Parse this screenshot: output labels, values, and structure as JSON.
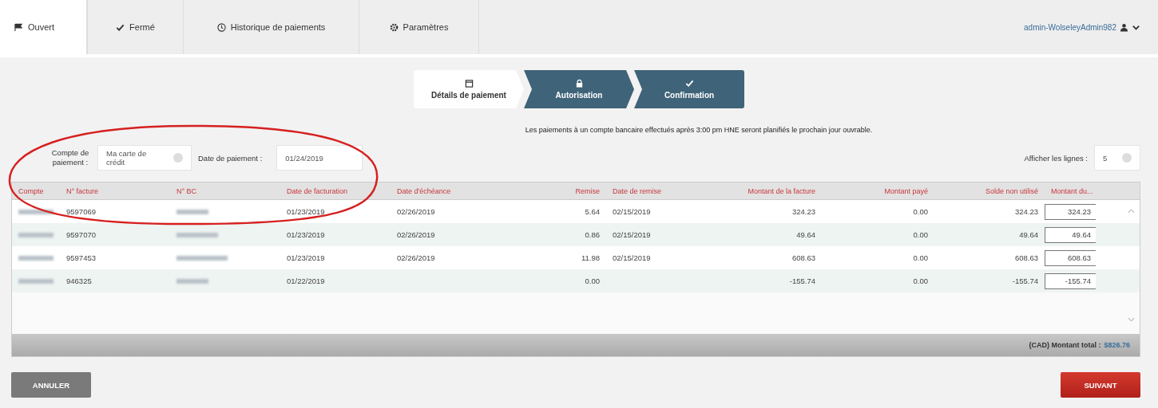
{
  "tabs": [
    {
      "label": "Ouvert",
      "selected": true
    },
    {
      "label": "Fermé",
      "selected": false
    },
    {
      "label": "Historique de paiements",
      "selected": false
    },
    {
      "label": "Paramètres",
      "selected": false
    }
  ],
  "user": {
    "name": "admin-WolseleyAdmin982"
  },
  "stepper": [
    {
      "label": "Détails de paiement",
      "selected": true
    },
    {
      "label": "Autorisation",
      "selected": false
    },
    {
      "label": "Confirmation",
      "selected": false
    }
  ],
  "notice": "Les paiements à un compte bancaire effectués après 3:00 pm HNE seront planifiés le prochain jour ouvrable.",
  "form": {
    "account_label": "Compte de paiement :",
    "account_value": "Ma carte de crédit",
    "date_label": "Date de paiement :",
    "date_value": "01/24/2019",
    "rows_label": "Afficher les lignes :",
    "rows_value": "5"
  },
  "table": {
    "columns": [
      "Compte",
      "N° facture",
      "N° BC",
      "Date de facturation",
      "Date d'échéance",
      "Remise",
      "Date de remise",
      "Montant de la facture",
      "Montant payé",
      "Solde non utilisé",
      "Montant du..."
    ],
    "rows": [
      {
        "invoice": "9597069",
        "billing_date": "01/23/2019",
        "due_date": "02/26/2019",
        "discount": "5.64",
        "discount_date": "02/15/2019",
        "invoice_amount": "324.23",
        "paid": "0.00",
        "balance": "324.23",
        "amount_due": "324.23"
      },
      {
        "invoice": "9597070",
        "billing_date": "01/23/2019",
        "due_date": "02/26/2019",
        "discount": "0.86",
        "discount_date": "02/15/2019",
        "invoice_amount": "49.64",
        "paid": "0.00",
        "balance": "49.64",
        "amount_due": "49.64"
      },
      {
        "invoice": "9597453",
        "billing_date": "01/23/2019",
        "due_date": "02/26/2019",
        "discount": "11.98",
        "discount_date": "02/15/2019",
        "invoice_amount": "608.63",
        "paid": "0.00",
        "balance": "608.63",
        "amount_due": "608.63"
      },
      {
        "invoice": "946325",
        "billing_date": "01/22/2019",
        "discount": "0.00",
        "invoice_amount": "-155.74",
        "paid": "0.00",
        "balance": "-155.74",
        "amount_due": "-155.74"
      }
    ],
    "total_label": "(CAD) Montant total :",
    "total_value": "$826.76"
  },
  "buttons": [
    {
      "label": "ANNULER",
      "kind": "cancel"
    },
    {
      "label": "SUIVANT",
      "kind": "next"
    }
  ]
}
